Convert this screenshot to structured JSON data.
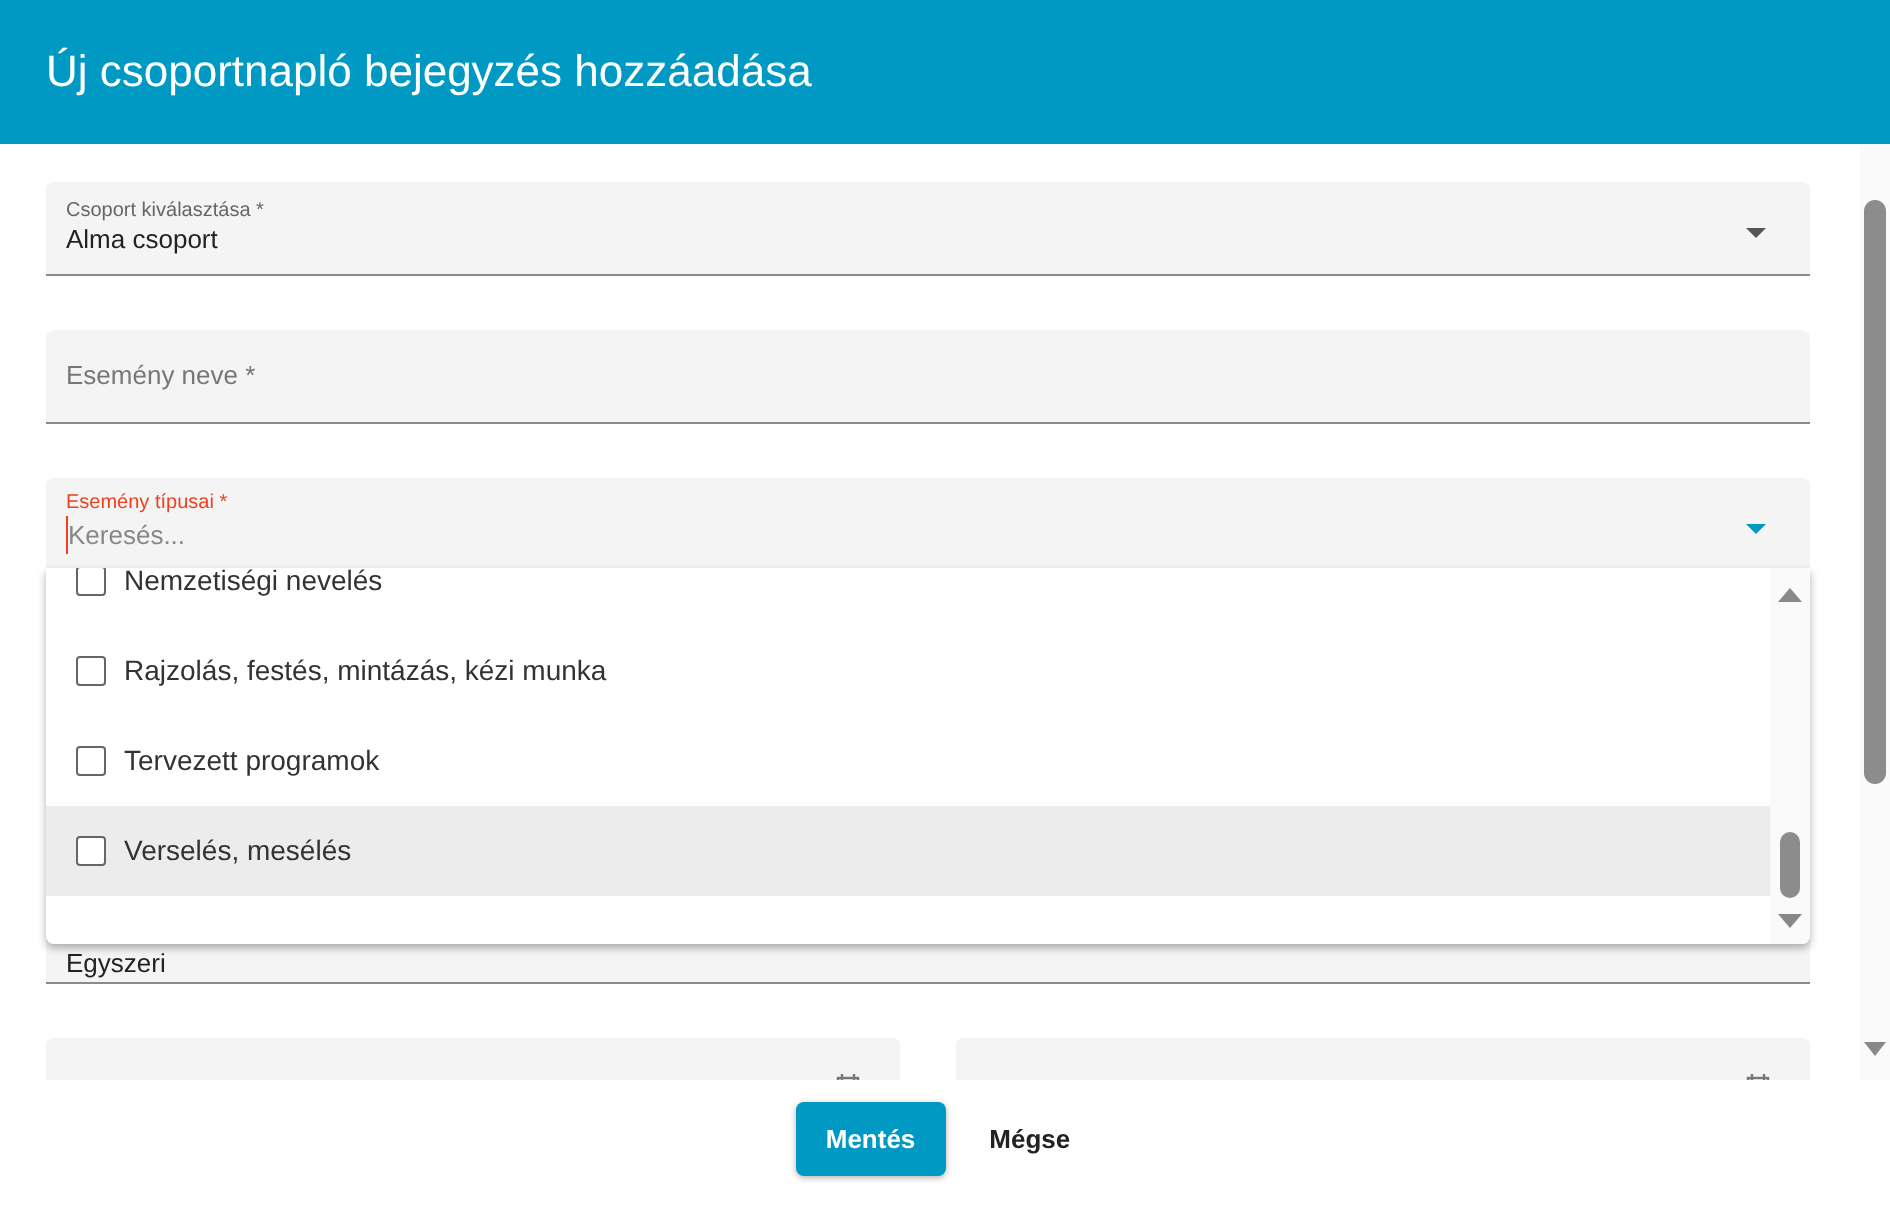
{
  "dialog": {
    "title": "Új csoportnapló bejegyzés hozzáadása"
  },
  "fields": [
    {
      "kind": "select",
      "label": "Csoport kiválasztása *",
      "value": "Alma csoport"
    },
    {
      "kind": "text",
      "label": "Esemény neve *"
    },
    {
      "kind": "multiselect",
      "label": "Esemény típusai *",
      "placeholder": "Keresés...",
      "focused": true,
      "options": [
        {
          "label": "Nemzetiségi nevelés",
          "checked": false,
          "highlighted": false
        },
        {
          "label": "Rajzolás, festés, mintázás, kézi munka",
          "checked": false,
          "highlighted": false
        },
        {
          "label": "Tervezett programok",
          "checked": false,
          "highlighted": false
        },
        {
          "label": "Verselés, mesélés",
          "checked": false,
          "highlighted": true
        }
      ]
    },
    {
      "kind": "select",
      "value": "Egyszeri"
    },
    {
      "kind": "date_pair"
    }
  ],
  "buttons": [
    {
      "label": "Mentés",
      "kind": "primary"
    },
    {
      "label": "Mégse",
      "kind": "text"
    }
  ]
}
